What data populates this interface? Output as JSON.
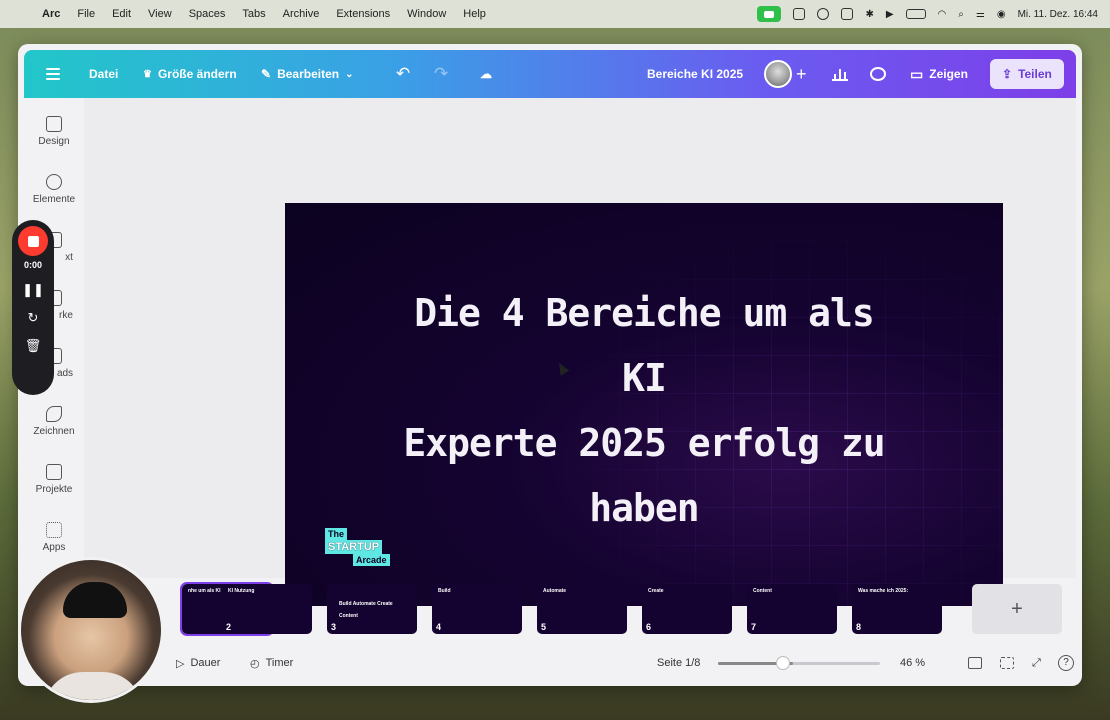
{
  "menubar": {
    "app": "Arc",
    "items": [
      "File",
      "Edit",
      "View",
      "Spaces",
      "Tabs",
      "Archive",
      "Extensions",
      "Window",
      "Help"
    ],
    "datetime": "Mi. 11. Dez.  16:44"
  },
  "appbar": {
    "datei": "Datei",
    "groesse": "Größe ändern",
    "bearbeiten": "Bearbeiten",
    "title": "Bereiche KI 2025",
    "zeigen": "Zeigen",
    "teilen": "Teilen"
  },
  "sidebar": {
    "items": [
      {
        "label": "Design",
        "icon": "layout-icon"
      },
      {
        "label": "Elemente",
        "icon": "shapes-icon"
      },
      {
        "label": "xt",
        "icon": "text-icon"
      },
      {
        "label": "rke",
        "icon": "brand-icon"
      },
      {
        "label": "ads",
        "icon": "uploads-icon"
      },
      {
        "label": "Zeichnen",
        "icon": "draw-icon"
      },
      {
        "label": "Projekte",
        "icon": "folder-icon"
      },
      {
        "label": "Apps",
        "icon": "apps-icon"
      }
    ]
  },
  "recorder": {
    "time": "0:00"
  },
  "slide": {
    "line1": "Die 4 Bereiche um als KI",
    "line2": "Experte 2025 erfolg zu",
    "line3": "haben",
    "logo": {
      "l1": "The",
      "l2": "STARTUP",
      "l3": "Arcade"
    }
  },
  "thumbnails": [
    {
      "num": "",
      "title": "nhe um als KI 25 erfolg zu ben"
    },
    {
      "num": "2",
      "title": "KI Nutzung"
    },
    {
      "num": "3",
      "title": "Build   Automate   Create   Content"
    },
    {
      "num": "4",
      "title": "Build"
    },
    {
      "num": "5",
      "title": "Automate"
    },
    {
      "num": "6",
      "title": "Create"
    },
    {
      "num": "7",
      "title": "Content"
    },
    {
      "num": "8",
      "title": "Was mache ich 2025:"
    }
  ],
  "bottombar": {
    "dauer": "Dauer",
    "timer": "Timer",
    "page": "Seite 1/8",
    "zoom": "46 %",
    "zoom_value": 0.46
  }
}
